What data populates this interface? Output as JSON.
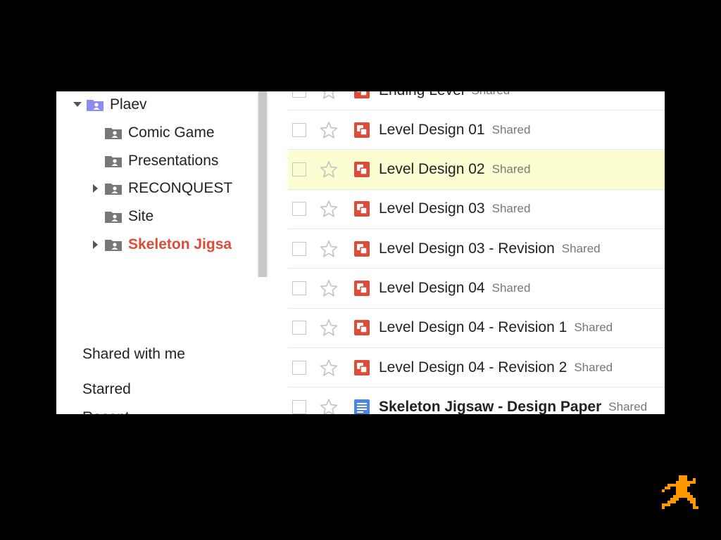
{
  "sidebar": {
    "tree": [
      {
        "label": "Plaev",
        "expander": "down",
        "folder_color": "#8c8cf2",
        "active": false
      },
      {
        "label": "Comic Game",
        "expander": "none",
        "folder_color": "#777777",
        "active": false
      },
      {
        "label": "Presentations",
        "expander": "none",
        "folder_color": "#777777",
        "active": false
      },
      {
        "label": "RECONQUEST",
        "expander": "right",
        "folder_color": "#777777",
        "active": false
      },
      {
        "label": "Site",
        "expander": "none",
        "folder_color": "#777777",
        "active": false
      },
      {
        "label": "Skeleton Jigsa",
        "expander": "right",
        "folder_color": "#777777",
        "active": true
      }
    ],
    "links": [
      {
        "label": "Shared with me"
      },
      {
        "label": "Starred"
      },
      {
        "label": "Recent"
      }
    ]
  },
  "files": [
    {
      "name": "Ending Level",
      "status": "Shared",
      "type": "drawing",
      "selected": false,
      "bold": false
    },
    {
      "name": "Level Design 01",
      "status": "Shared",
      "type": "drawing",
      "selected": false,
      "bold": false
    },
    {
      "name": "Level Design 02",
      "status": "Shared",
      "type": "drawing",
      "selected": true,
      "bold": false
    },
    {
      "name": "Level Design 03",
      "status": "Shared",
      "type": "drawing",
      "selected": false,
      "bold": false
    },
    {
      "name": "Level Design 03 - Revision",
      "status": "Shared",
      "type": "drawing",
      "selected": false,
      "bold": false
    },
    {
      "name": "Level Design 04",
      "status": "Shared",
      "type": "drawing",
      "selected": false,
      "bold": false
    },
    {
      "name": "Level Design 04 - Revision 1",
      "status": "Shared",
      "type": "drawing",
      "selected": false,
      "bold": false
    },
    {
      "name": "Level Design 04 - Revision 2",
      "status": "Shared",
      "type": "drawing",
      "selected": false,
      "bold": false
    },
    {
      "name": "Skeleton Jigsaw - Design Paper",
      "status": "Shared",
      "type": "document",
      "selected": false,
      "bold": true
    }
  ],
  "colors": {
    "drawing_icon": "#dd4b39",
    "document_icon": "#4a86e8",
    "active_folder_text": "#dd4b39",
    "selected_row": "#fdfdd2",
    "star_outline": "#c2c2c2",
    "mascot": "#ff9800"
  },
  "icons": {
    "drawing": "drawing-file-icon",
    "document": "document-file-icon",
    "folder": "shared-folder-icon",
    "star": "star-outline-icon",
    "mascot": "running-pixel-man-icon"
  }
}
